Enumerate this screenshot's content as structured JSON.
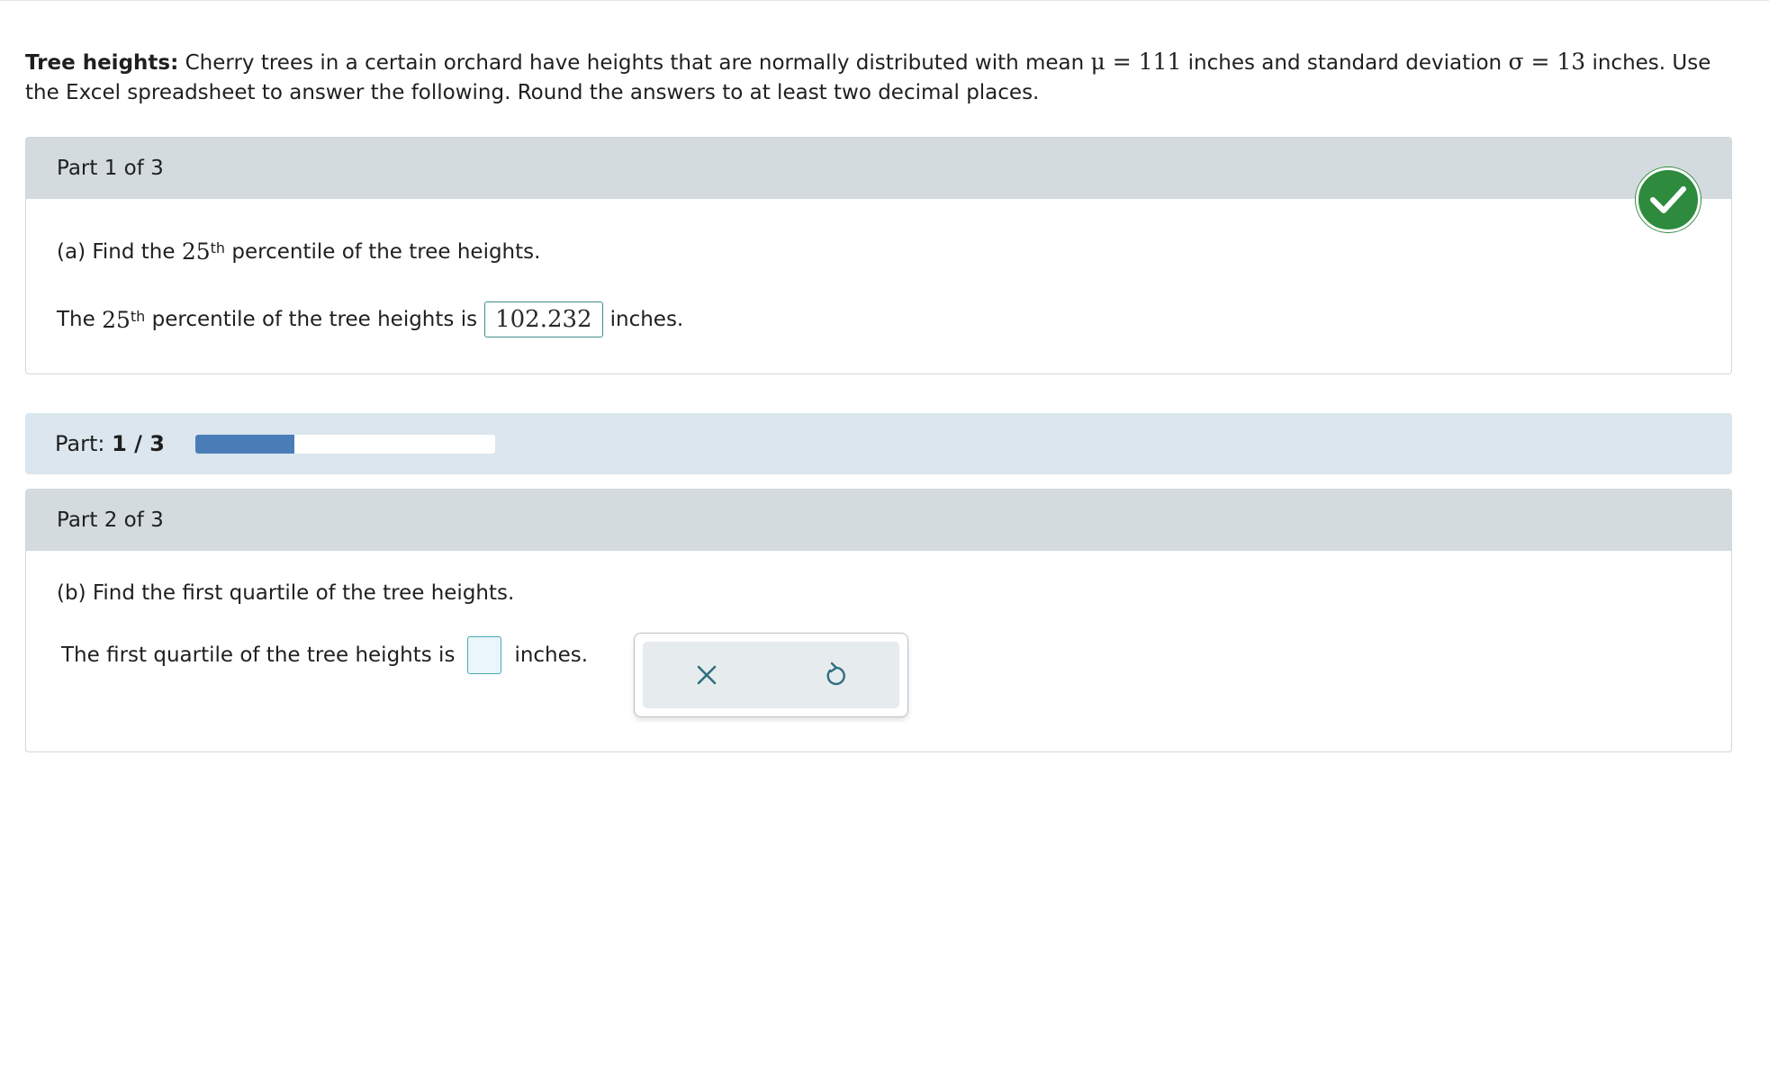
{
  "problem": {
    "title": "Tree heights:",
    "text_before_mean": "Cherry trees in a certain orchard have heights that are normally distributed with mean",
    "mean_expr": "μ = 111",
    "text_between": "inches and standard deviation",
    "sd_expr": "σ = 13",
    "text_after": "inches. Use the Excel spreadsheet to answer the following. Round the answers to at least two decimal places."
  },
  "part1": {
    "header": "Part 1 of 3",
    "question_prefix": "(a) Find the",
    "number": "25",
    "superscript": "th",
    "question_suffix": "percentile of the tree heights.",
    "answer_prefix": "The",
    "answer_middle": "percentile of the tree heights is",
    "answer_value": "102.232",
    "answer_unit": "inches.",
    "status": "correct",
    "status_color": "#2e8b3e"
  },
  "progress": {
    "label": "Part:",
    "current": "1",
    "separator": "/",
    "total": "3",
    "fraction": 0.33,
    "fill_color": "#4a7db8"
  },
  "part2": {
    "header": "Part 2 of 3",
    "question": "(b) Find the first quartile of the tree heights.",
    "answer_prefix": "The first quartile of the tree heights is",
    "answer_value": "",
    "answer_unit": "inches."
  },
  "tools": {
    "clear_icon": "close-icon",
    "undo_icon": "undo-icon"
  }
}
